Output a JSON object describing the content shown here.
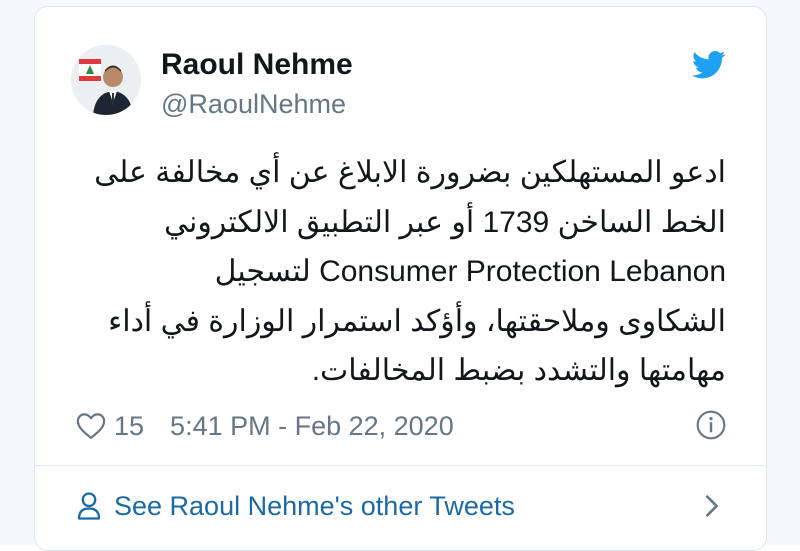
{
  "tweet": {
    "author": {
      "display_name": "Raoul Nehme",
      "handle": "@RaoulNehme"
    },
    "text_lines": [
      "ادعو المستهلكين بضرورة الابلاغ عن أي مخالفة على",
      "الخط الساخن 1739 أو عبر التطبيق الالكتروني",
      "Consumer Protection Lebanon لتسجيل",
      "الشكاوى وملاحقتها، وأؤكد استمرار الوزارة في أداء",
      "مهامتها والتشدد بضبط المخالفات."
    ],
    "like_count": "15",
    "timestamp": "5:41 PM - Feb 22, 2020"
  },
  "footer": {
    "link_label": "See Raoul Nehme's other Tweets"
  },
  "icons": {
    "brand": "twitter-bird-icon",
    "like": "heart-icon",
    "info": "info-icon",
    "profile": "person-icon",
    "chevron": "chevron-right-icon"
  },
  "colors": {
    "twitter_blue": "#1da1f2",
    "link_blue": "#1b6aa5",
    "secondary_text": "#657786",
    "primary_text": "#14171a"
  }
}
